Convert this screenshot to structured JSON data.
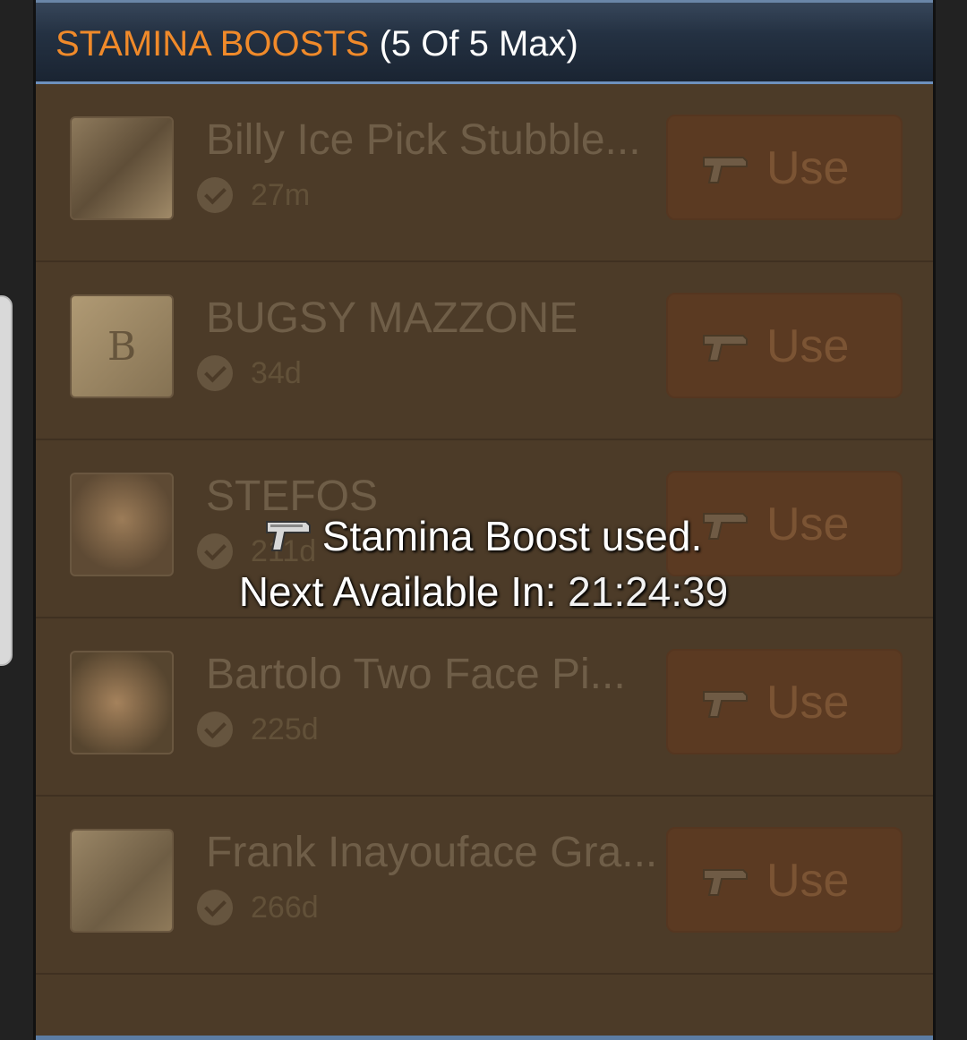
{
  "header": {
    "title": "STAMINA BOOSTS",
    "count": "(5 Of 5 Max)"
  },
  "rows": [
    {
      "name": "Billy Ice Pick Stubble...",
      "time": "27m",
      "button": "Use",
      "thumb_icon": "portrait-photo"
    },
    {
      "name": "BUGSY MAZZONE",
      "time": "34d",
      "button": "Use",
      "thumb_icon": "bugsy-logo"
    },
    {
      "name": "STEFOS",
      "time": "211d",
      "button": "Use",
      "thumb_icon": "portrait-photo"
    },
    {
      "name": "Bartolo Two Face Pi...",
      "time": "225d",
      "button": "Use",
      "thumb_icon": "portrait-photo"
    },
    {
      "name": "Frank Inayouface Gra...",
      "time": "266d",
      "button": "Use",
      "thumb_icon": "drawing"
    }
  ],
  "toast": {
    "line1": "Stamina Boost used.",
    "line2_label": "Next Available In:",
    "timer": "21:24:39"
  },
  "colors": {
    "title_orange": "#f08a2a",
    "panel_brown": "#4c3b28",
    "header_navy": "#243142",
    "button_brown": "#5b3a22"
  }
}
